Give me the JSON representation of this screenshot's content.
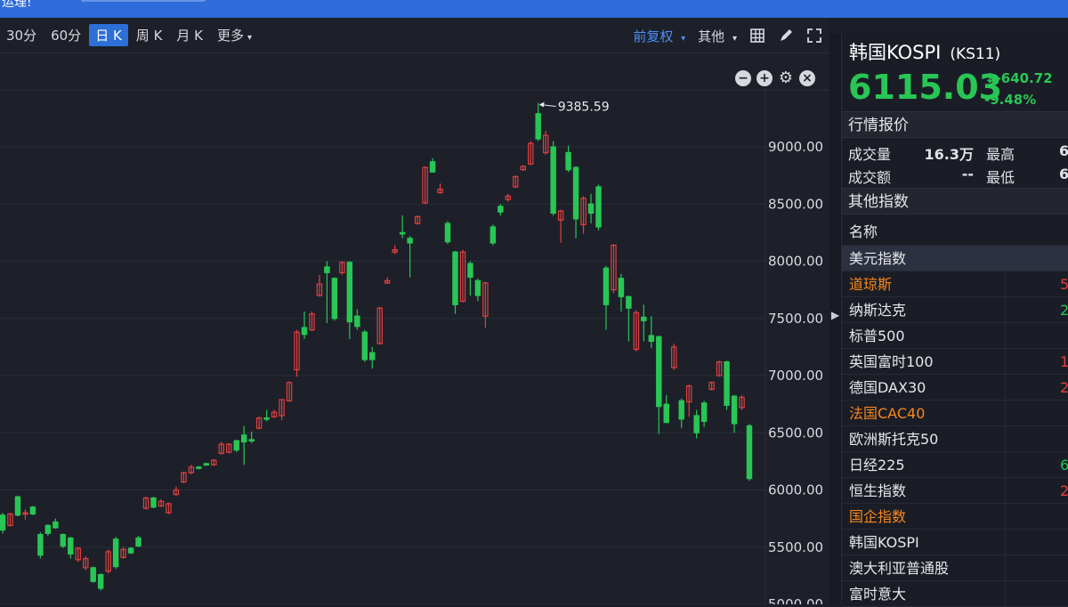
{
  "topbar": {
    "text": "运理!"
  },
  "toolbar": {
    "timeframes": [
      "30分",
      "60分",
      "日 K",
      "周 K",
      "月 K",
      "更多"
    ],
    "active_timeframe": "日 K",
    "adjust_label": "前复权",
    "other_label": "其他"
  },
  "chart_data": {
    "type": "candlestick",
    "y_ticks": [
      "9000.00",
      "8500.00",
      "8000.00",
      "7500.00",
      "7000.00",
      "6500.00",
      "6000.00",
      "5500.00",
      "5000.00"
    ],
    "y_tick_values": [
      9000,
      8500,
      8000,
      7500,
      7000,
      6500,
      6000,
      5500,
      5000
    ],
    "ylim": [
      4990,
      9440
    ],
    "peak_label": "9385.59",
    "peak_value": 9385.59,
    "up_color": "#e14040",
    "down_color": "#28c655",
    "candles": [
      {
        "o": 5780,
        "c": 5650,
        "h": 5800,
        "l": 5620
      },
      {
        "o": 5690,
        "c": 5790,
        "h": 5800,
        "l": 5680
      },
      {
        "o": 5940,
        "c": 5780,
        "h": 5950,
        "l": 5770
      },
      {
        "o": 5790,
        "c": 5800,
        "h": 5830,
        "l": 5740
      },
      {
        "o": 5850,
        "c": 5790,
        "h": 5860,
        "l": 5780
      },
      {
        "o": 5610,
        "c": 5430,
        "h": 5630,
        "l": 5400
      },
      {
        "o": 5690,
        "c": 5620,
        "h": 5700,
        "l": 5600
      },
      {
        "o": 5720,
        "c": 5670,
        "h": 5750,
        "l": 5660
      },
      {
        "o": 5610,
        "c": 5510,
        "h": 5620,
        "l": 5490
      },
      {
        "o": 5580,
        "c": 5440,
        "h": 5590,
        "l": 5400
      },
      {
        "o": 5390,
        "c": 5490,
        "h": 5500,
        "l": 5370
      },
      {
        "o": 5320,
        "c": 5400,
        "h": 5420,
        "l": 5300
      },
      {
        "o": 5320,
        "c": 5200,
        "h": 5330,
        "l": 5190
      },
      {
        "o": 5260,
        "c": 5140,
        "h": 5270,
        "l": 5120
      },
      {
        "o": 5290,
        "c": 5460,
        "h": 5480,
        "l": 5270
      },
      {
        "o": 5570,
        "c": 5330,
        "h": 5590,
        "l": 5310
      },
      {
        "o": 5410,
        "c": 5480,
        "h": 5500,
        "l": 5400
      },
      {
        "o": 5490,
        "c": 5450,
        "h": 5500,
        "l": 5440
      },
      {
        "o": 5580,
        "c": 5510,
        "h": 5600,
        "l": 5500
      },
      {
        "o": 5840,
        "c": 5930,
        "h": 5940,
        "l": 5830
      },
      {
        "o": 5930,
        "c": 5850,
        "h": 5940,
        "l": 5840
      },
      {
        "o": 5860,
        "c": 5900,
        "h": 5920,
        "l": 5850
      },
      {
        "o": 5800,
        "c": 5880,
        "h": 5890,
        "l": 5790
      },
      {
        "o": 5960,
        "c": 6000,
        "h": 6030,
        "l": 5950
      },
      {
        "o": 6070,
        "c": 6150,
        "h": 6160,
        "l": 6060
      },
      {
        "o": 6150,
        "c": 6200,
        "h": 6220,
        "l": 6140
      },
      {
        "o": 6200,
        "c": 6190,
        "h": 6210,
        "l": 6180
      },
      {
        "o": 6230,
        "c": 6220,
        "h": 6240,
        "l": 6210
      },
      {
        "o": 6220,
        "c": 6260,
        "h": 6270,
        "l": 6210
      },
      {
        "o": 6320,
        "c": 6400,
        "h": 6420,
        "l": 6310
      },
      {
        "o": 6330,
        "c": 6400,
        "h": 6410,
        "l": 6320
      },
      {
        "o": 6430,
        "c": 6350,
        "h": 6440,
        "l": 6330
      },
      {
        "o": 6480,
        "c": 6420,
        "h": 6560,
        "l": 6220
      },
      {
        "o": 6440,
        "c": 6430,
        "h": 6510,
        "l": 6410
      },
      {
        "o": 6540,
        "c": 6630,
        "h": 6640,
        "l": 6530
      },
      {
        "o": 6630,
        "c": 6620,
        "h": 6700,
        "l": 6600
      },
      {
        "o": 6640,
        "c": 6680,
        "h": 6700,
        "l": 6630
      },
      {
        "o": 6650,
        "c": 6790,
        "h": 6790,
        "l": 6610
      },
      {
        "o": 6780,
        "c": 6940,
        "h": 6950,
        "l": 6770
      },
      {
        "o": 7050,
        "c": 7380,
        "h": 7400,
        "l": 6990
      },
      {
        "o": 7420,
        "c": 7360,
        "h": 7560,
        "l": 7320
      },
      {
        "o": 7400,
        "c": 7540,
        "h": 7560,
        "l": 7390
      },
      {
        "o": 7700,
        "c": 7800,
        "h": 7880,
        "l": 7690
      },
      {
        "o": 7950,
        "c": 7900,
        "h": 8000,
        "l": 7460
      },
      {
        "o": 7850,
        "c": 7500,
        "h": 7860,
        "l": 7480
      },
      {
        "o": 7900,
        "c": 7990,
        "h": 8000,
        "l": 7880
      },
      {
        "o": 7990,
        "c": 7470,
        "h": 8000,
        "l": 7320
      },
      {
        "o": 7520,
        "c": 7430,
        "h": 7580,
        "l": 7400
      },
      {
        "o": 7380,
        "c": 7140,
        "h": 7400,
        "l": 7120
      },
      {
        "o": 7200,
        "c": 7140,
        "h": 7250,
        "l": 7060
      },
      {
        "o": 7280,
        "c": 7590,
        "h": 7600,
        "l": 7270
      },
      {
        "o": 7810,
        "c": 7830,
        "h": 7860,
        "l": 7800
      },
      {
        "o": 8080,
        "c": 8100,
        "h": 8140,
        "l": 8060
      },
      {
        "o": 8250,
        "c": 8240,
        "h": 8400,
        "l": 8200
      },
      {
        "o": 8200,
        "c": 8160,
        "h": 8220,
        "l": 7860
      },
      {
        "o": 8330,
        "c": 8390,
        "h": 8400,
        "l": 8320
      },
      {
        "o": 8510,
        "c": 8820,
        "h": 8830,
        "l": 8500
      },
      {
        "o": 8870,
        "c": 8780,
        "h": 8900,
        "l": 8780
      },
      {
        "o": 8600,
        "c": 8630,
        "h": 8680,
        "l": 8590
      },
      {
        "o": 8330,
        "c": 8170,
        "h": 8350,
        "l": 8150
      },
      {
        "o": 8080,
        "c": 7620,
        "h": 8090,
        "l": 7540
      },
      {
        "o": 7650,
        "c": 8080,
        "h": 8100,
        "l": 7640
      },
      {
        "o": 7980,
        "c": 7860,
        "h": 8000,
        "l": 7700
      },
      {
        "o": 7830,
        "c": 7700,
        "h": 7850,
        "l": 7650
      },
      {
        "o": 7520,
        "c": 7810,
        "h": 7820,
        "l": 7420
      },
      {
        "o": 8300,
        "c": 8160,
        "h": 8320,
        "l": 8140
      },
      {
        "o": 8480,
        "c": 8430,
        "h": 8500,
        "l": 8400
      },
      {
        "o": 8540,
        "c": 8570,
        "h": 8590,
        "l": 8520
      },
      {
        "o": 8650,
        "c": 8740,
        "h": 8750,
        "l": 8640
      },
      {
        "o": 8800,
        "c": 8830,
        "h": 8840,
        "l": 8790
      },
      {
        "o": 8850,
        "c": 9030,
        "h": 9050,
        "l": 8840
      },
      {
        "o": 9290,
        "c": 9070,
        "h": 9385.59,
        "l": 9050
      },
      {
        "o": 8950,
        "c": 9100,
        "h": 9140,
        "l": 8930
      },
      {
        "o": 9000,
        "c": 8420,
        "h": 9050,
        "l": 8400
      },
      {
        "o": 8360,
        "c": 8440,
        "h": 8450,
        "l": 8160
      },
      {
        "o": 8950,
        "c": 8800,
        "h": 9010,
        "l": 8780
      },
      {
        "o": 8820,
        "c": 8370,
        "h": 8830,
        "l": 8200
      },
      {
        "o": 8320,
        "c": 8550,
        "h": 8570,
        "l": 8240
      },
      {
        "o": 8500,
        "c": 8420,
        "h": 8590,
        "l": 8330
      },
      {
        "o": 8650,
        "c": 8300,
        "h": 8670,
        "l": 8270
      },
      {
        "o": 7940,
        "c": 7620,
        "h": 7960,
        "l": 7400
      },
      {
        "o": 7750,
        "c": 8140,
        "h": 8150,
        "l": 7720
      },
      {
        "o": 7850,
        "c": 7690,
        "h": 7890,
        "l": 7560
      },
      {
        "o": 7690,
        "c": 7590,
        "h": 7700,
        "l": 7300
      },
      {
        "o": 7230,
        "c": 7550,
        "h": 7570,
        "l": 7210
      },
      {
        "o": 7510,
        "c": 7480,
        "h": 7620,
        "l": 7300
      },
      {
        "o": 7350,
        "c": 7300,
        "h": 7520,
        "l": 7240
      },
      {
        "o": 7340,
        "c": 6730,
        "h": 7350,
        "l": 6490
      },
      {
        "o": 6750,
        "c": 6590,
        "h": 6830,
        "l": 6680
      },
      {
        "o": 7070,
        "c": 7250,
        "h": 7280,
        "l": 7050
      },
      {
        "o": 6780,
        "c": 6620,
        "h": 6800,
        "l": 6540
      },
      {
        "o": 6770,
        "c": 6910,
        "h": 6920,
        "l": 6640
      },
      {
        "o": 6650,
        "c": 6500,
        "h": 6700,
        "l": 6450
      },
      {
        "o": 6760,
        "c": 6600,
        "h": 6780,
        "l": 6550
      },
      {
        "o": 6880,
        "c": 6940,
        "h": 6950,
        "l": 6870
      },
      {
        "o": 7000,
        "c": 7120,
        "h": 7130,
        "l": 6990
      },
      {
        "o": 7120,
        "c": 6740,
        "h": 7130,
        "l": 6700
      },
      {
        "o": 6820,
        "c": 6580,
        "h": 6830,
        "l": 6500
      },
      {
        "o": 6720,
        "c": 6810,
        "h": 6830,
        "l": 6700
      },
      {
        "o": 6560,
        "c": 6100,
        "h": 6580,
        "l": 6080
      }
    ]
  },
  "side": {
    "name": "韩国KOSPI",
    "code": "(KS11)",
    "price": "6115.03",
    "change": "↓-640.72",
    "change_pct": "-9.48%",
    "quote_title": "行情报价",
    "volume_label": "成交量",
    "volume_value": "16.3万",
    "high_label": "最高",
    "high_value": "6",
    "amount_label": "成交额",
    "amount_value": "--",
    "low_label": "最低",
    "low_value": "6",
    "other_title": "其他指数",
    "col_name": "名称",
    "rows": [
      {
        "name": "美元指数",
        "val": "",
        "type": "sel"
      },
      {
        "name": "道琼斯",
        "val": "5",
        "type": "hl"
      },
      {
        "name": "纳斯达克",
        "val": "2",
        "type": "g"
      },
      {
        "name": "标普500",
        "val": "",
        "type": ""
      },
      {
        "name": "英国富时100",
        "val": "1",
        "type": ""
      },
      {
        "name": "德国DAX30",
        "val": "2",
        "type": ""
      },
      {
        "name": "法国CAC40",
        "val": "",
        "type": "hl"
      },
      {
        "name": "欧洲斯托克50",
        "val": "",
        "type": ""
      },
      {
        "name": "日经225",
        "val": "6",
        "type": "g"
      },
      {
        "name": "恒生指数",
        "val": "2",
        "type": ""
      },
      {
        "name": "国企指数",
        "val": "",
        "type": "hl"
      },
      {
        "name": "韩国KOSPI",
        "val": "",
        "type": ""
      },
      {
        "name": "澳大利亚普通股",
        "val": "",
        "type": ""
      },
      {
        "name": "富时意大",
        "val": "",
        "type": ""
      }
    ]
  }
}
